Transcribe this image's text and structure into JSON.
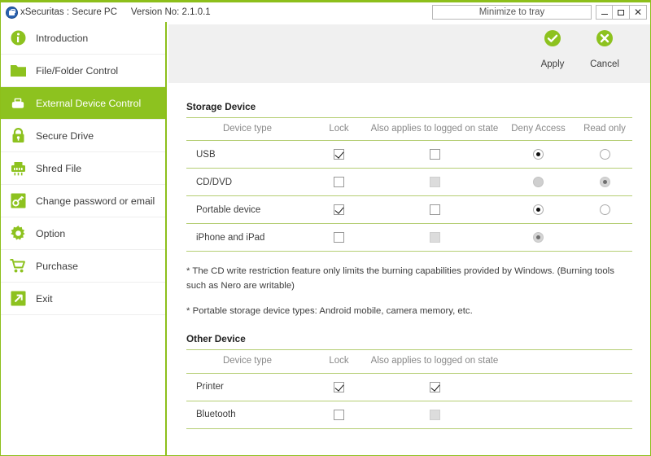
{
  "window": {
    "title": "xSecuritas : Secure PC",
    "version": "Version No: 2.1.0.1",
    "minimize_to_tray": "Minimize to tray",
    "minimize_label": "–",
    "maximize_label": "□",
    "close_label": "✕",
    "accent_color": "#8dc21f",
    "border_color": "#b5ce74"
  },
  "sidebar": {
    "items": [
      {
        "label": "Introduction",
        "icon": "info-icon",
        "active": false
      },
      {
        "label": "File/Folder Control",
        "icon": "folder-icon",
        "active": false
      },
      {
        "label": "External Device Control",
        "icon": "usb-icon",
        "active": true
      },
      {
        "label": "Secure Drive",
        "icon": "lock-icon",
        "active": false
      },
      {
        "label": "Shred File",
        "icon": "shredder-icon",
        "active": false
      },
      {
        "label": "Change password or email",
        "icon": "key-icon",
        "active": false
      },
      {
        "label": "Option",
        "icon": "gear-icon",
        "active": false
      },
      {
        "label": "Purchase",
        "icon": "cart-icon",
        "active": false
      },
      {
        "label": "Exit",
        "icon": "exit-arrow-icon",
        "active": false
      }
    ]
  },
  "toolbar": {
    "apply_label": "Apply",
    "cancel_label": "Cancel",
    "apply_icon": "check-circle-icon",
    "cancel_icon": "cross-circle-icon"
  },
  "storage_section": {
    "title": "Storage Device",
    "columns": [
      "Device type",
      "Lock",
      "Also applies to logged on state",
      "Deny Access",
      "Read only"
    ],
    "rows": [
      {
        "device": "USB",
        "lock": {
          "state": "checked",
          "disabled": false
        },
        "also": {
          "state": "unchecked",
          "disabled": false
        },
        "deny": {
          "state": "selected",
          "disabled": false
        },
        "read": {
          "state": "unselected",
          "disabled": false
        }
      },
      {
        "device": "CD/DVD",
        "lock": {
          "state": "unchecked",
          "disabled": false
        },
        "also": {
          "state": "unchecked",
          "disabled": true
        },
        "deny": {
          "state": "unselected",
          "disabled": true
        },
        "read": {
          "state": "selected",
          "disabled": true
        }
      },
      {
        "device": "Portable device",
        "lock": {
          "state": "checked",
          "disabled": false
        },
        "also": {
          "state": "unchecked",
          "disabled": false
        },
        "deny": {
          "state": "selected",
          "disabled": false
        },
        "read": {
          "state": "unselected",
          "disabled": false
        }
      },
      {
        "device": "iPhone and iPad",
        "lock": {
          "state": "unchecked",
          "disabled": false
        },
        "also": {
          "state": "unchecked",
          "disabled": true
        },
        "deny": {
          "state": "selected",
          "disabled": true
        },
        "read": {
          "state": "none",
          "disabled": true
        }
      }
    ]
  },
  "notes": [
    "* The CD write restriction feature only limits the burning capabilities provided by Windows. (Burning tools such as Nero are writable)",
    "* Portable storage device types: Android mobile, camera memory, etc."
  ],
  "other_section": {
    "title": "Other Device",
    "columns": [
      "Device type",
      "Lock",
      "Also applies to logged on state"
    ],
    "rows": [
      {
        "device": "Printer",
        "lock": {
          "state": "checked",
          "disabled": false
        },
        "also": {
          "state": "checked",
          "disabled": false
        }
      },
      {
        "device": "Bluetooth",
        "lock": {
          "state": "unchecked",
          "disabled": false
        },
        "also": {
          "state": "unchecked",
          "disabled": true
        }
      }
    ]
  }
}
